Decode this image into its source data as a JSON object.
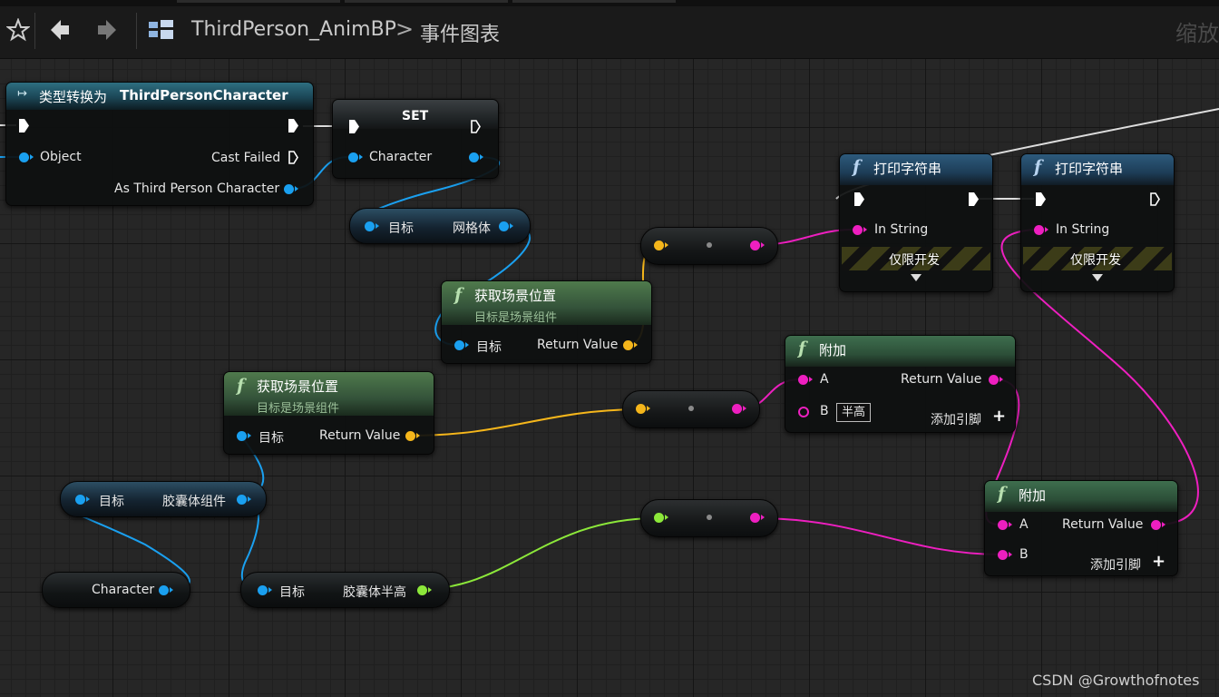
{
  "toolbar": {
    "breadcrumb_blueprint": "ThirdPerson_AnimBP",
    "breadcrumb_separator": ">",
    "breadcrumb_graph": "事件图表",
    "zoom_label": "缩放"
  },
  "nodes": {
    "cast": {
      "title_prefix": "类型转换为",
      "title_class": "ThirdPersonCharacter",
      "object_label": "Object",
      "cast_failed_label": "Cast Failed",
      "as_label": "As Third Person Character"
    },
    "set": {
      "title": "SET",
      "pin_label": "Character"
    },
    "get_mesh": {
      "target_label": "目标",
      "output_label": "网格体"
    },
    "get_loc_1": {
      "title": "获取场景位置",
      "subtitle": "目标是场景组件",
      "target_label": "目标",
      "return_label": "Return Value"
    },
    "get_loc_2": {
      "title": "获取场景位置",
      "subtitle": "目标是场景组件",
      "target_label": "目标",
      "return_label": "Return Value"
    },
    "print_1": {
      "title": "打印字符串",
      "in_string_label": "In String",
      "dev_only_label": "仅限开发"
    },
    "print_2": {
      "title": "打印字符串",
      "in_string_label": "In String",
      "dev_only_label": "仅限开发"
    },
    "add_1": {
      "title": "附加",
      "a_label": "A",
      "b_label": "B",
      "b_default": "半高",
      "return_label": "Return Value",
      "add_pin_label": "添加引脚"
    },
    "add_2": {
      "title": "附加",
      "a_label": "A",
      "b_label": "B",
      "return_label": "Return Value",
      "add_pin_label": "添加引脚"
    },
    "get_capsule": {
      "target_label": "目标",
      "output_label": "胶囊体组件"
    },
    "get_half_height": {
      "target_label": "目标",
      "output_label": "胶囊体半高"
    },
    "character_var": {
      "label": "Character"
    }
  },
  "pin_colors": {
    "object": "#1aa0f0",
    "vector": "#f5b61b",
    "string": "#ee1fc0",
    "float": "#8ce83a",
    "exec": "#ffffff"
  },
  "watermark": "CSDN @Growthofnotes"
}
